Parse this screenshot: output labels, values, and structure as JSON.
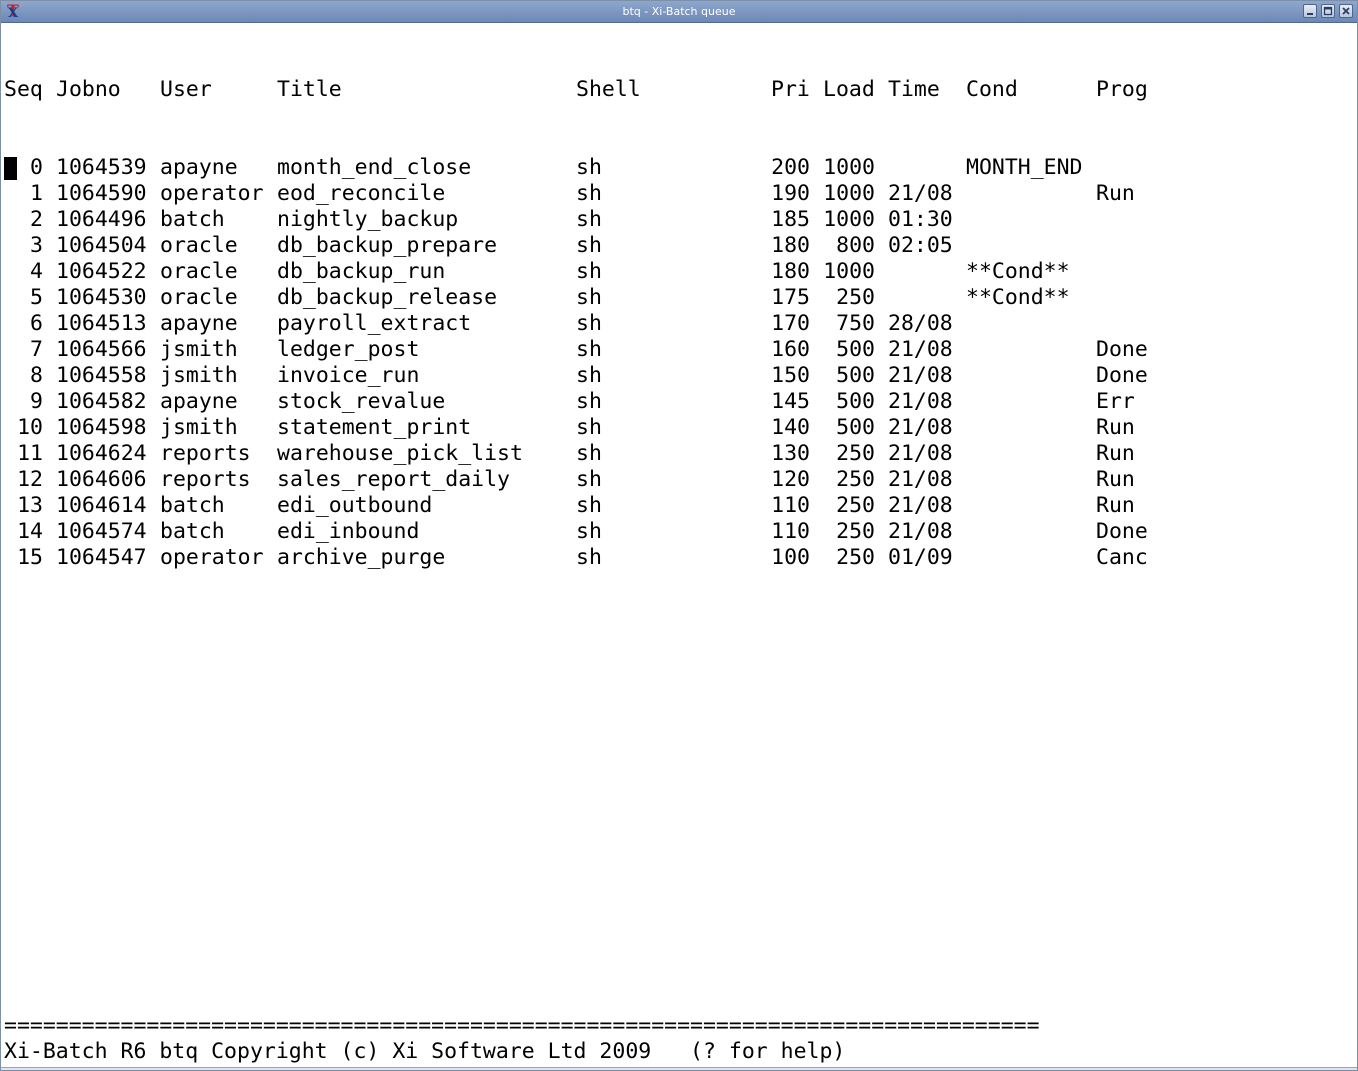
{
  "window": {
    "title": "btq - Xi-Batch queue"
  },
  "columns": {
    "seq": "Seq",
    "jobno": "Jobno",
    "user": "User",
    "title": "Title",
    "shell": "Shell",
    "pri": "Pri",
    "load": "Load",
    "time": "Time",
    "cond": "Cond",
    "prog": "Prog"
  },
  "jobs": [
    {
      "seq": "0",
      "jobno": "1064539",
      "user": "apayne",
      "title": "month_end_close",
      "shell": "sh",
      "pri": "200",
      "load": "1000",
      "time": "",
      "cond": "MONTH_END",
      "prog": ""
    },
    {
      "seq": "1",
      "jobno": "1064590",
      "user": "operator",
      "title": "eod_reconcile",
      "shell": "sh",
      "pri": "190",
      "load": "1000",
      "time": "21/08",
      "cond": "",
      "prog": "Run"
    },
    {
      "seq": "2",
      "jobno": "1064496",
      "user": "batch",
      "title": "nightly_backup",
      "shell": "sh",
      "pri": "185",
      "load": "1000",
      "time": "01:30",
      "cond": "",
      "prog": ""
    },
    {
      "seq": "3",
      "jobno": "1064504",
      "user": "oracle",
      "title": "db_backup_prepare",
      "shell": "sh",
      "pri": "180",
      "load": "800",
      "time": "02:05",
      "cond": "",
      "prog": ""
    },
    {
      "seq": "4",
      "jobno": "1064522",
      "user": "oracle",
      "title": "db_backup_run",
      "shell": "sh",
      "pri": "180",
      "load": "1000",
      "time": "",
      "cond": "**Cond**",
      "prog": ""
    },
    {
      "seq": "5",
      "jobno": "1064530",
      "user": "oracle",
      "title": "db_backup_release",
      "shell": "sh",
      "pri": "175",
      "load": "250",
      "time": "",
      "cond": "**Cond**",
      "prog": ""
    },
    {
      "seq": "6",
      "jobno": "1064513",
      "user": "apayne",
      "title": "payroll_extract",
      "shell": "sh",
      "pri": "170",
      "load": "750",
      "time": "28/08",
      "cond": "",
      "prog": ""
    },
    {
      "seq": "7",
      "jobno": "1064566",
      "user": "jsmith",
      "title": "ledger_post",
      "shell": "sh",
      "pri": "160",
      "load": "500",
      "time": "21/08",
      "cond": "",
      "prog": "Done"
    },
    {
      "seq": "8",
      "jobno": "1064558",
      "user": "jsmith",
      "title": "invoice_run",
      "shell": "sh",
      "pri": "150",
      "load": "500",
      "time": "21/08",
      "cond": "",
      "prog": "Done"
    },
    {
      "seq": "9",
      "jobno": "1064582",
      "user": "apayne",
      "title": "stock_revalue",
      "shell": "sh",
      "pri": "145",
      "load": "500",
      "time": "21/08",
      "cond": "",
      "prog": "Err"
    },
    {
      "seq": "10",
      "jobno": "1064598",
      "user": "jsmith",
      "title": "statement_print",
      "shell": "sh",
      "pri": "140",
      "load": "500",
      "time": "21/08",
      "cond": "",
      "prog": "Run"
    },
    {
      "seq": "11",
      "jobno": "1064624",
      "user": "reports",
      "title": "warehouse_pick_list",
      "shell": "sh",
      "pri": "130",
      "load": "250",
      "time": "21/08",
      "cond": "",
      "prog": "Run"
    },
    {
      "seq": "12",
      "jobno": "1064606",
      "user": "reports",
      "title": "sales_report_daily",
      "shell": "sh",
      "pri": "120",
      "load": "250",
      "time": "21/08",
      "cond": "",
      "prog": "Run"
    },
    {
      "seq": "13",
      "jobno": "1064614",
      "user": "batch",
      "title": "edi_outbound",
      "shell": "sh",
      "pri": "110",
      "load": "250",
      "time": "21/08",
      "cond": "",
      "prog": "Run"
    },
    {
      "seq": "14",
      "jobno": "1064574",
      "user": "batch",
      "title": "edi_inbound",
      "shell": "sh",
      "pri": "110",
      "load": "250",
      "time": "21/08",
      "cond": "",
      "prog": "Done"
    },
    {
      "seq": "15",
      "jobno": "1064547",
      "user": "operator",
      "title": "archive_purge",
      "shell": "sh",
      "pri": "100",
      "load": "250",
      "time": "01/09",
      "cond": "",
      "prog": "Canc"
    }
  ],
  "footer": {
    "rule": "================================================================================",
    "status": "Xi-Batch R6 btq Copyright (c) Xi Software Ltd 2009   (? for help)"
  }
}
